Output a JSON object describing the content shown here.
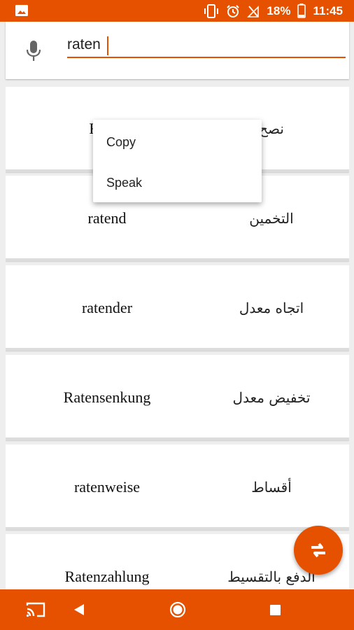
{
  "status_bar": {
    "battery_text": "18%",
    "time": "11:45",
    "icons": [
      "image-icon",
      "vibrate-icon",
      "alarm-icon",
      "no-signal-icon",
      "battery-icon"
    ]
  },
  "search": {
    "value": "raten",
    "icon": "mic-icon"
  },
  "results": [
    {
      "german": "Raten",
      "arabic": "نصح"
    },
    {
      "german": "ratend",
      "arabic": "التخمين"
    },
    {
      "german": "ratender",
      "arabic": "اتجاه معدل"
    },
    {
      "german": "Ratensenkung",
      "arabic": "تخفيض معدل"
    },
    {
      "german": "ratenweise",
      "arabic": "أقساط"
    },
    {
      "german": "Ratenzahlung",
      "arabic": "الدفع بالتقسيط"
    }
  ],
  "context_menu": {
    "items": [
      "Copy",
      "Speak"
    ]
  },
  "fab": {
    "icon": "swap-languages-icon"
  },
  "nav_bar": {
    "icons": [
      "cast-icon",
      "back-icon",
      "home-icon",
      "recents-icon"
    ]
  },
  "colors": {
    "accent": "#e65100",
    "background": "#eeeeee",
    "card": "#ffffff"
  }
}
